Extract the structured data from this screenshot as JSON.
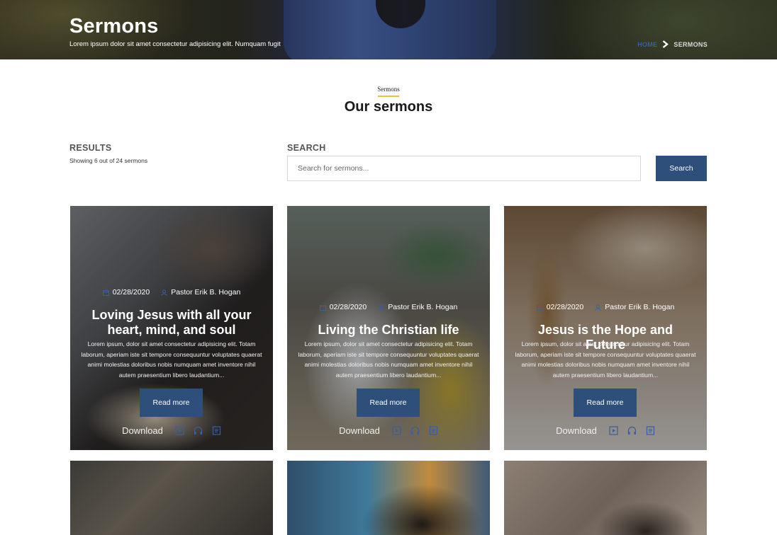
{
  "hero": {
    "title": "Sermons",
    "subtitle": "Lorem ipsum dolor sit amet consectetur adipisicing elit. Numquam fugit",
    "breadcrumb": {
      "home": "HOME",
      "current": "SERMONS"
    }
  },
  "section": {
    "eyebrow": "Sermons",
    "title": "Our sermons"
  },
  "results": {
    "label": "RESULTS",
    "count_text": "Showing 6 out of 24 sermons"
  },
  "search": {
    "label": "SEARCH",
    "placeholder": "Search for sermons...",
    "button": "Search"
  },
  "sermons": [
    {
      "date": "02/28/2020",
      "pastor": "Pastor Erik B. Hogan",
      "title": "Loving Jesus with all your heart, mind, and soul",
      "excerpt": "Lorem ipsum, dolor sit amet consectetur adipisicing elit. Totam laborum, aperiam iste sit tempore consequuntur voluptates quaerat animi molestias doloribus nobis numquam amet inventore nihil autem praesentium libero laudantium...",
      "read_more": "Read more",
      "download": "Download",
      "icons": [
        "video-icon",
        "headphones-icon",
        "document-icon"
      ]
    },
    {
      "date": "02/28/2020",
      "pastor": "Pastor Erik B. Hogan",
      "title": "Living the Christian life",
      "excerpt": "Lorem ipsum, dolor sit amet consectetur adipisicing elit. Totam laborum, aperiam iste sit tempore consequuntur voluptates quaerat animi molestias doloribus nobis numquam amet inventore nihil autem praesentium libero laudantium...",
      "read_more": "Read more",
      "download": "Download",
      "icons": [
        "video-icon",
        "headphones-icon",
        "document-icon"
      ]
    },
    {
      "date": "02/28/2020",
      "pastor": "Pastor Erik B. Hogan",
      "title": "Jesus is the Hope and Future",
      "excerpt": "Lorem ipsum, dolor sit amet consectetur adipisicing elit. Totam laborum, aperiam iste sit tempore consequuntur voluptates quaerat animi molestias doloribus nobis numquam amet inventore nihil autem praesentium libero laudantium...",
      "read_more": "Read more",
      "download": "Download",
      "icons": [
        "video-icon",
        "headphones-icon",
        "document-icon"
      ]
    }
  ],
  "colors": {
    "primary": "#2d4f7a",
    "accent": "#e8c23a",
    "breadcrumb_home": "#3a5f9a"
  }
}
